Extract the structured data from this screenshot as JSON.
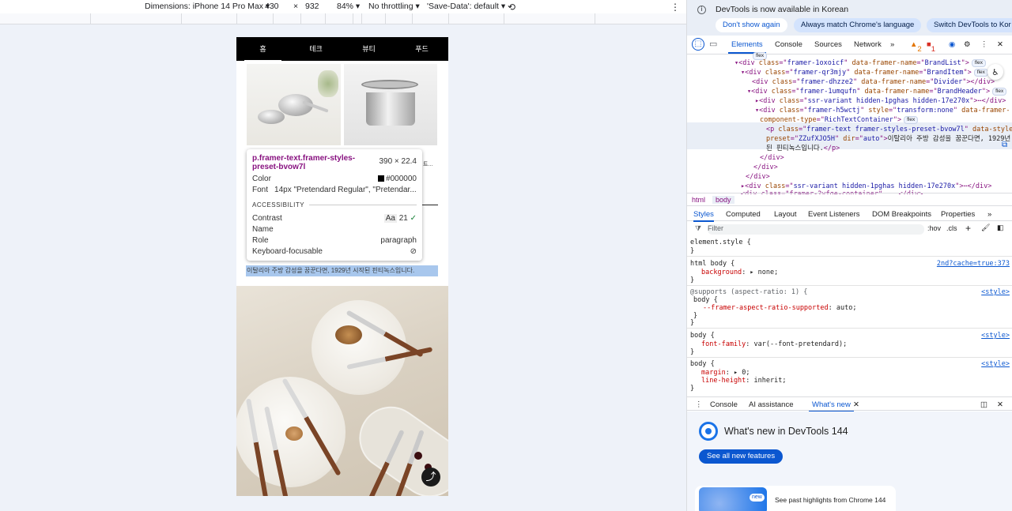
{
  "device_toolbar": {
    "dimensions": "Dimensions: iPhone 14 Pro Max",
    "width": "430",
    "times": "×",
    "height": "932",
    "zoom": "84%",
    "throttling": "No throttling",
    "save_data": "'Save-Data': default"
  },
  "site": {
    "tabs": [
      "홈",
      "테크",
      "뷰티",
      "푸드"
    ],
    "selected_text": "이탈리아 주방 감성을 꿈꾼다면, 1929년 시작된 핀티녹스입니다.",
    "partial_text": "트..."
  },
  "tooltip": {
    "selector": "p.framer-text.framer-styles-preset-bvow7l",
    "size": "390 × 22.4",
    "color_label": "Color",
    "color_value": "#000000",
    "font_label": "Font",
    "font_value": "14px \"Pretendard Regular\", \"Pretendar...",
    "accessibility": "ACCESSIBILITY",
    "contrast_label": "Contrast",
    "contrast_aa": "Aa",
    "contrast_value": "21",
    "name_label": "Name",
    "role_label": "Role",
    "role_value": "paragraph",
    "focus_label": "Keyboard-focusable"
  },
  "infobar": {
    "message": "DevTools is now available in Korean",
    "dont_show": "Don't show again",
    "match_lang": "Always match Chrome's language",
    "switch": "Switch DevTools to Kor"
  },
  "devtools_tabs": [
    "Elements",
    "Console",
    "Sources",
    "Network"
  ],
  "issues": {
    "warnings": "2",
    "errors": "1"
  },
  "dom": {
    "flex": "flex",
    "l0_open": "<div class=\"",
    "l1": {
      "cls": "framer-1oxoicf",
      "name": "BrandList"
    },
    "l2": {
      "cls": "framer-qr3mjy",
      "name": "BrandItem"
    },
    "l3": {
      "cls": "framer-dhzze2",
      "name": "Divider"
    },
    "l4": {
      "cls": "framer-1umqufn",
      "name": "BrandHeader"
    },
    "l5": {
      "cls": "ssr-variant hidden-1pghas hidden-17e270x"
    },
    "l6": {
      "cls": "framer-h5wctj",
      "style": "transform:none",
      "component": "RichTextContainer"
    },
    "l7": {
      "cls": "framer-text framer-styles-preset-bvow7l",
      "preset": "ZZufXJO5H",
      "dir": "auto",
      "text": "이탈리아 주방 감성을 꿈꾼다면, 1929년 시작",
      "text2": "된 핀티녹스입니다."
    },
    "close_p": "</p>",
    "close_div": "</div>",
    "l8": {
      "cls": "ssr-variant hidden-1pghas hidden-17e270x"
    },
    "l9": "<div class=\"framer-2vfqe-container\" ...</div>"
  },
  "breadcrumbs": [
    "html",
    "body"
  ],
  "styles_tabs": [
    "Styles",
    "Computed",
    "Layout",
    "Event Listeners",
    "DOM Breakpoints",
    "Properties"
  ],
  "filter": {
    "placeholder": "Filter",
    "hov": ":hov",
    "cls": ".cls"
  },
  "css": {
    "element_style": "element.style {",
    "close": "}",
    "html_body": "html body {",
    "html_body_src": "2nd?cache=true:373",
    "background_prop": "background",
    "background_val": "none;",
    "supports": "@supports (aspect-ratio: 1) {",
    "body": "body {",
    "aspect_prop": "--framer-aspect-ratio-supported",
    "aspect_val": "auto;",
    "style_src": "<style>",
    "font_prop": "font-family",
    "font_val": "var(--font-pretendard);",
    "margin_prop": "margin",
    "margin_val": "0;",
    "lh_prop": "line-height",
    "lh_val": "inherit;"
  },
  "drawer_tabs": [
    "Console",
    "AI assistance",
    "What's new"
  ],
  "whats_new": {
    "title": "What's new in DevTools 144",
    "button": "See all new features",
    "badge": "new",
    "past": "See past highlights from Chrome 144"
  }
}
